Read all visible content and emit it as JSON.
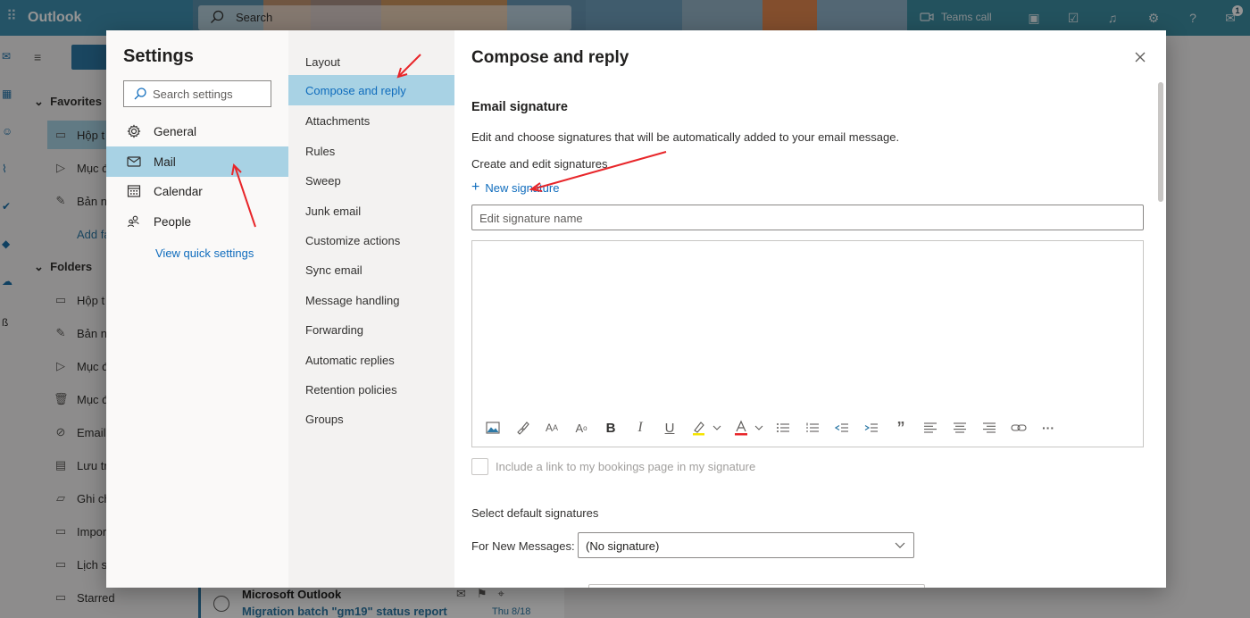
{
  "app": {
    "name": "Outlook",
    "search_label": "Search",
    "teams_call": "Teams call",
    "notification_badge": "1"
  },
  "folder_pane": {
    "favorites": "Favorites",
    "favorite_items": [
      "Hộp t",
      "Mục đ",
      "Bản n"
    ],
    "add_favorite": "Add fa",
    "folders": "Folders",
    "folder_items": [
      "Hộp t",
      "Bản n",
      "Mục đ",
      "Mục đ",
      "Email",
      "Lưu tr",
      "Ghi ch",
      "Impor",
      "Lịch s",
      "Starred"
    ]
  },
  "message_peek": {
    "from": "Microsoft Outlook",
    "subject": "Migration batch \"gm19\" status report",
    "date": "Thu 8/18"
  },
  "settings": {
    "title": "Settings",
    "search_placeholder": "Search settings",
    "categories": [
      {
        "label": "General",
        "icon": "gear-icon"
      },
      {
        "label": "Mail",
        "icon": "mail-icon",
        "selected": true
      },
      {
        "label": "Calendar",
        "icon": "calendar-icon"
      },
      {
        "label": "People",
        "icon": "people-icon"
      }
    ],
    "quick_settings": "View quick settings",
    "mail_subcategories": [
      "Layout",
      "Compose and reply",
      "Attachments",
      "Rules",
      "Sweep",
      "Junk email",
      "Customize actions",
      "Sync email",
      "Message handling",
      "Forwarding",
      "Automatic replies",
      "Retention policies",
      "Groups"
    ],
    "selected_subcategory": "Compose and reply"
  },
  "compose": {
    "title": "Compose and reply",
    "signature_heading": "Email signature",
    "signature_desc": "Edit and choose signatures that will be automatically added to your email message.",
    "create_label": "Create and edit signatures",
    "new_signature": "New signature",
    "signature_name_placeholder": "Edit signature name",
    "bookings_link": "Include a link to my bookings page in my signature",
    "default_sig_label": "Select default signatures",
    "new_messages_label": "For New Messages:",
    "new_messages_value": "(No signature)",
    "toolbar": [
      "insert-image-icon",
      "format-painter-icon",
      "font-size-icon",
      "superscript-icon",
      "bold-icon",
      "italic-icon",
      "underline-icon",
      "highlight-icon",
      "font-color-icon",
      "bullets-icon",
      "numbering-icon",
      "decrease-indent-icon",
      "increase-indent-icon",
      "quote-icon",
      "align-left-icon",
      "align-center-icon",
      "align-right-icon",
      "link-icon",
      "more-icon"
    ],
    "toolbar_glyphs": {
      "font_size": "A",
      "superscript": "A",
      "bold": "B",
      "italic": "I",
      "underline": "U",
      "quote": "”",
      "more": "···"
    }
  },
  "colors": {
    "accent": "#0f6cbd",
    "selected_bg": "#a8d2e4",
    "annotation_arrow": "#e8262a"
  }
}
